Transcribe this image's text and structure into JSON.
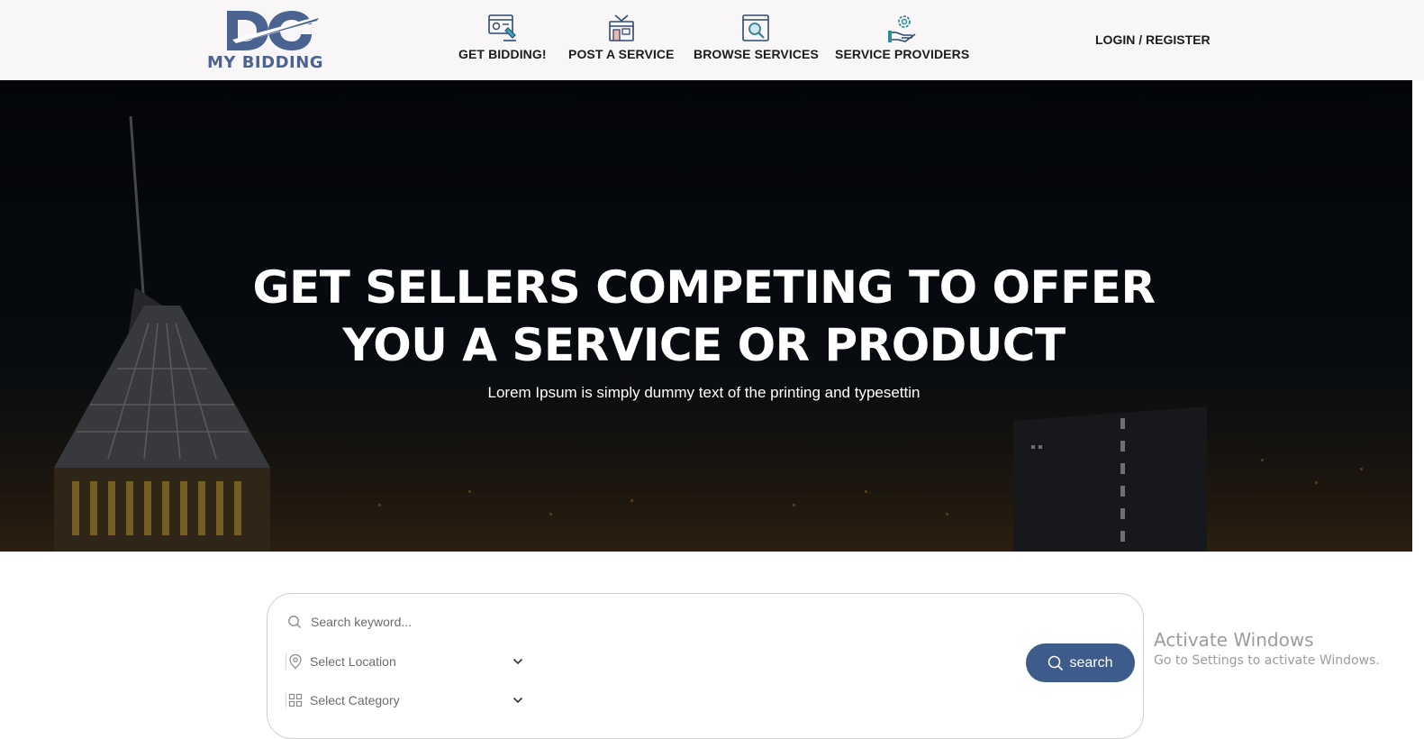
{
  "brand": {
    "logo_text": "MY BIDDING",
    "primary_color": "#4b6391",
    "accent_color": "#3d5c8c"
  },
  "nav": {
    "items": [
      {
        "label": "GET BIDDING!",
        "icon": "bidding-browser-icon"
      },
      {
        "label": "POST A SERVICE",
        "icon": "store-post-icon"
      },
      {
        "label": "BROWSE SERVICES",
        "icon": "browse-search-icon"
      },
      {
        "label": "SERVICE PROVIDERS",
        "icon": "hand-gear-icon"
      }
    ],
    "login_label": "LOGIN / REGISTER"
  },
  "hero": {
    "title_line1": "GET SELLERS COMPETING TO OFFER",
    "title_line2": "YOU A SERVICE OR PRODUCT",
    "subtitle": "Lorem Ipsum is simply dummy text of the printing and typesettin"
  },
  "search": {
    "keyword_placeholder": "Search keyword...",
    "location_label": "Select Location",
    "category_label": "Select Category",
    "button_label": "search"
  },
  "watermark": {
    "title": "Activate Windows",
    "subtitle": "Go to Settings to activate Windows."
  }
}
